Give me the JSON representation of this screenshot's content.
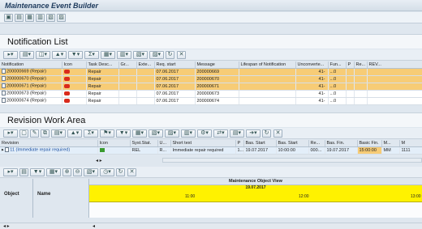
{
  "app": {
    "title": "Maintenance Event Builder"
  },
  "notification_list": {
    "title": "Notification List",
    "columns": [
      "Notification",
      "Icon",
      "Task Desc...",
      "Gr...",
      "Exte...",
      "Req. start",
      "Message",
      "Lifespan of Notification",
      "Unconverte...",
      "Fun...",
      "P",
      "Re...",
      "REV..."
    ],
    "rows": [
      {
        "notification": "200000669 (Repair)",
        "task": "Repair",
        "req_start": "07.06.2017",
        "message": "200000669",
        "unconv": "41-",
        "fun": "...0",
        "selected": true
      },
      {
        "notification": "200000670 (Repair)",
        "task": "Repair",
        "req_start": "07.06.2017",
        "message": "200000670",
        "unconv": "41-",
        "fun": "...0",
        "selected": true
      },
      {
        "notification": "200000671 (Repair)",
        "task": "Repair",
        "req_start": "07.06.2017",
        "message": "200000671",
        "unconv": "41-",
        "fun": "...0",
        "selected": true
      },
      {
        "notification": "200000673 (Repair)",
        "task": "Repair",
        "req_start": "07.06.2017",
        "message": "200000673",
        "unconv": "41-",
        "fun": "...0",
        "selected": false
      },
      {
        "notification": "200000674 (Repair)",
        "task": "Repair",
        "req_start": "07.06.2017",
        "message": "200000674",
        "unconv": "41-",
        "fun": "...0",
        "selected": false
      }
    ]
  },
  "revision_work_area": {
    "title": "Revision Work Area",
    "columns": [
      "Revision",
      "Icon",
      "Syst.Stat.",
      "U...",
      "Short text",
      "P",
      "Bas. Start",
      "Bas. Start",
      "Re...",
      "Bas. Fin.",
      "Basic Fin.",
      "M...",
      "M"
    ],
    "row": {
      "revision": "11 (Immediate repair required)",
      "status": "REL",
      "u": "R...",
      "short_text": "Immediate repair required",
      "p": "1...",
      "bas_start_date": "19.07.2017",
      "bas_start_time": "10:00:00",
      "re": "000...",
      "bas_fin_date": "19.07.2017",
      "basic_fin": "15:00:00",
      "m1": "MM",
      "m2": "1111"
    }
  },
  "object_view": {
    "title": "Maintenance Object View",
    "col_object": "Object",
    "col_name": "Name",
    "date": "19.07.2017",
    "times": [
      "11:00",
      "12:00",
      "13:00"
    ]
  },
  "colors": {
    "selected_row": "#f7cc76",
    "timeline": "#fff200",
    "stop_icon": "#d92a1c"
  }
}
